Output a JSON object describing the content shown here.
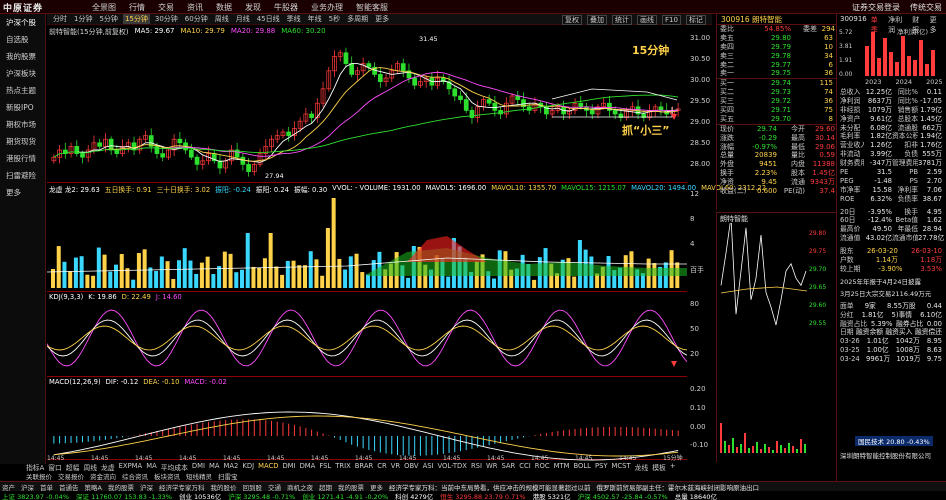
{
  "logo": "中原证券",
  "topmenu": [
    "全景图",
    "行情",
    "交易",
    "资讯",
    "数据",
    "发现",
    "牛股器",
    "业务办理",
    "智能客服"
  ],
  "topright": [
    "证券交易登录",
    "传统交易"
  ],
  "sidebar": [
    "沪深个股",
    "自选股",
    "我的股票",
    "沪深板块",
    "热点主题",
    "新股IPO",
    "期权市场",
    "期货现货",
    "港股行情",
    "扫雷避险",
    "更多"
  ],
  "toolbar": {
    "periods": [
      "分时",
      "1分钟",
      "5分钟",
      "15分钟",
      "30分钟",
      "60分钟",
      "周线",
      "月线",
      "45日线",
      "季线",
      "年线",
      "5秒",
      "多周期",
      "更多"
    ],
    "selected": "15分钟",
    "right": [
      "复权",
      "叠加",
      "统计",
      "画线",
      "F10",
      "标记"
    ]
  },
  "chart": {
    "title": "前特智能(15分钟,前复权)",
    "ma": [
      {
        "label": "MA5: 29.67",
        "color": "#ffffff"
      },
      {
        "label": "MA10: 29.79",
        "color": "#ffd24a"
      },
      {
        "label": "MA20: 29.88",
        "color": "#ff4dff"
      },
      {
        "label": "MA60: 30.20",
        "color": "#2ee02e"
      }
    ],
    "high_label": "31.45",
    "low_label": "27.94",
    "annot_period": "15分钟",
    "annot_pattern": "抓“小三”",
    "axis": [
      "31.00",
      "30.50",
      "30.00",
      "29.50",
      "29.00",
      "28.50",
      "28.00"
    ]
  },
  "vol": {
    "labels": [
      {
        "t": "龙虚 龙2: 29.63",
        "c": "#ffffff"
      },
      {
        "t": "五日换手: 0.91",
        "c": "#ffd24a"
      },
      {
        "t": "三十日换手: 3.02",
        "c": "#ffd24a"
      },
      {
        "t": "振阳: -0.24",
        "c": "#3ad8ff"
      },
      {
        "t": "振阳: 0.24",
        "c": "#ffffff"
      },
      {
        "t": "振幅: 0.30",
        "c": "#ffffff"
      },
      {
        "t": "VVOL: - VOLUME: 1931.00",
        "c": "#ffffff"
      },
      {
        "t": "MAVOL5: 1696.00",
        "c": "#ffffff"
      },
      {
        "t": "MAVOL10: 1355.70",
        "c": "#ffd24a"
      },
      {
        "t": "MAVOL15: 1215.07",
        "c": "#2ee02e"
      },
      {
        "t": "MAVOL20: 1494.00",
        "c": "#3ad8ff"
      },
      {
        "t": "MAVOL60: 2312.22",
        "c": "#ffd24a"
      }
    ],
    "axis": [
      "12",
      "8",
      "4",
      "百手"
    ]
  },
  "kdj": {
    "labels": [
      {
        "t": "KDJ(9,3,3)",
        "c": "#ffffff"
      },
      {
        "t": "K: 19.86",
        "c": "#ffffff"
      },
      {
        "t": "D: 22.49",
        "c": "#ffd24a"
      },
      {
        "t": "J: 14.60",
        "c": "#ff4dff"
      }
    ],
    "axis": [
      "80",
      "50",
      "20"
    ]
  },
  "macd": {
    "labels": [
      {
        "t": "MACD(12,26,9)",
        "c": "#ffffff"
      },
      {
        "t": "DIF: -0.12",
        "c": "#ffffff"
      },
      {
        "t": "DEA: -0.10",
        "c": "#ffd24a"
      },
      {
        "t": "MACD: -0.02",
        "c": "#ff4dff"
      }
    ],
    "axis": [
      "0.20",
      "0.10",
      "0.00",
      "-0.10"
    ],
    "time": [
      "14:45",
      "14:45",
      "14:45",
      "14:45",
      "14:45",
      "14:45",
      "14:45",
      "14:45",
      "14:45",
      "14:45",
      "14:45",
      "14:45",
      "14:45",
      "14:45",
      "15分钟"
    ]
  },
  "tabs": [
    "指标A",
    "窗口",
    "超幅",
    "周线",
    "龙虚",
    "EXPMA",
    "MA",
    "平均成本",
    "DMI",
    "MA",
    "MA2",
    "KDJ",
    "MACD",
    "DMI",
    "DMA",
    "FSL",
    "TRIX",
    "BRAR",
    "CR",
    "VR",
    "OBV",
    "ASI",
    "VOL-TDX",
    "RSI",
    "WR",
    "SAR",
    "CCI",
    "ROC",
    "MTM",
    "BOLL",
    "PSY",
    "MCST",
    "龙线",
    "模板",
    "+"
  ],
  "tabs_selected": "MACD",
  "tabs2": [
    "关联报价",
    "交易报价",
    "资金流向",
    "综合资讯",
    "板块资讯",
    "短线精灵",
    "扫雷宝"
  ],
  "quote": {
    "header": "300916 朗特智能",
    "wei": {
      "l": "委比",
      "v": "54.85%",
      "l2": "委差",
      "v2": "294"
    },
    "sell": [
      {
        "l": "卖五",
        "p": "29.80",
        "q": "63"
      },
      {
        "l": "卖四",
        "p": "29.79",
        "q": "10"
      },
      {
        "l": "卖三",
        "p": "29.78",
        "q": "34"
      },
      {
        "l": "卖二",
        "p": "29.77",
        "q": "6"
      },
      {
        "l": "卖一",
        "p": "29.75",
        "q": "36"
      }
    ],
    "buy": [
      {
        "l": "买一",
        "p": "29.74",
        "q": "115"
      },
      {
        "l": "买二",
        "p": "29.73",
        "q": "74"
      },
      {
        "l": "买三",
        "p": "29.72",
        "q": "36"
      },
      {
        "l": "买四",
        "p": "29.71",
        "q": "75"
      },
      {
        "l": "买五",
        "p": "29.70",
        "q": "8"
      }
    ],
    "stats": [
      [
        "现价",
        "29.74",
        "今开",
        "29.60"
      ],
      [
        "涨跌",
        "-0.29",
        "最高",
        "30.14"
      ],
      [
        "涨幅",
        "-0.97%",
        "最低",
        "29.06"
      ],
      [
        "总量",
        "20839",
        "量比",
        "0.59"
      ],
      [
        "外盘",
        "9451",
        "内盘",
        "11388"
      ],
      [
        "换手",
        "2.23%",
        "股本",
        "1.45亿"
      ],
      [
        "净资",
        "9.45",
        "流通",
        "9343万"
      ],
      [
        "收益(二)",
        "0.600",
        "PE(动)",
        "37.4"
      ]
    ]
  },
  "mini": {
    "title": "朗特智能",
    "axis": [
      "29.80",
      "29.75",
      "29.70",
      "29.65",
      "29.60",
      "29.55"
    ],
    "time": [
      "09:30",
      "10:30",
      "11:30/13:00",
      "14:00",
      "15:00"
    ]
  },
  "right": {
    "code": "300916",
    "tabs": [
      "单季",
      "净利润",
      "财报",
      "更多"
    ],
    "bars_label": "净利润(亿)",
    "bar_axis": [
      "5.72",
      "3.81",
      "1.91",
      "0.00"
    ],
    "years": [
      "2023",
      "2024",
      "2025"
    ],
    "rows": [
      [
        "总收入",
        "12.25亿",
        "同比%",
        "0.11"
      ],
      [
        "净利润",
        "8637万",
        "同比%",
        "-17.05"
      ],
      [
        "非经损",
        "1079万",
        "销售额",
        "1.79亿"
      ],
      [
        "净资产",
        "9.61亿",
        "总股本",
        "1.45亿"
      ],
      [
        "未分配",
        "6.08亿",
        "流通股",
        "662万"
      ],
      [
        "毛利率",
        "1.82亿",
        "资本公积",
        "1.94亿"
      ],
      [
        "营业收入",
        "1.26亿",
        "扣非",
        "1.76亿"
      ],
      [
        "非流动",
        "3.99亿",
        "负债",
        "555万"
      ],
      [
        "财务费用",
        "-347万",
        "管理费用",
        "3781万"
      ],
      [
        "PE",
        "31.5",
        "PB",
        "2.59"
      ],
      [
        "PEG",
        "-1.48",
        "PS",
        "2.70"
      ],
      [
        "市净率",
        "15.58",
        "净利率",
        "7.06"
      ],
      [
        "ROE",
        "6.32%",
        "负债率",
        "38.67"
      ]
    ],
    "chg": [
      [
        "20日",
        "-3.95%",
        "换手",
        "4.95"
      ],
      [
        "60日",
        "-12.4%",
        "Beta值",
        "1.62"
      ],
      [
        "最高价",
        "49.50",
        "年最低",
        "28.94"
      ],
      [
        "流通值",
        "43.02亿",
        "流通市值",
        "27.78亿"
      ]
    ],
    "dates": [
      [
        "股东",
        "26-03-20",
        "26-03-10"
      ],
      [
        "户数",
        "1.14万",
        "1.18万"
      ],
      [
        "较上期",
        "-3.90%",
        "3.53%"
      ]
    ],
    "notice": "2025年年报于4月24日披露",
    "notice2": "3月25日大宗交易2116.49万元",
    "extra": [
      [
        "面单",
        "9家",
        "8.55万股",
        "0.44"
      ],
      [
        "分红",
        "1.81亿",
        "5)事情",
        "6.10亿"
      ],
      [
        "融资占比",
        "5.39%",
        "融券占比",
        "0.00"
      ],
      [
        "日期",
        "融资余额",
        "融资买入",
        "融资偿还"
      ],
      [
        "03-26",
        "1.01亿",
        "1042万",
        "8.95"
      ],
      [
        "03-25",
        "1.00亿",
        "1008万",
        "8.63"
      ],
      [
        "03-24",
        "9961万",
        "1019万",
        "9.75"
      ]
    ],
    "bottom": "国民技术 20.80 -0.43%",
    "company": "深圳朗特智能控制股份有限公司"
  },
  "bottom": [
    "资产",
    "沪深",
    "首单",
    "首通告",
    "策略A",
    "我的股票",
    "沪深",
    "经济学专家万科",
    "我的股价",
    "回到股",
    "交通",
    "商机之夜",
    "超期",
    "我的股票",
    "更多"
  ],
  "status": [
    {
      "t": "上证 3823.97 -0.04%",
      "c": "#2ee02e"
    },
    {
      "t": "深证 11760.07 153.83 -1.33%",
      "c": "#2ee02e"
    },
    {
      "t": "创业 10536亿",
      "c": "#ffffff"
    },
    {
      "t": "沪深 3295.48 -0.71%",
      "c": "#2ee02e"
    },
    {
      "t": "创业 1271.41 -4.91 -0.20%",
      "c": "#2ee02e"
    },
    {
      "t": "科创 4279亿",
      "c": "#ffffff"
    },
    {
      "t": "恒生 3295.88 23.79 0.71%",
      "c": "#ff3b3b"
    },
    {
      "t": "港股 5321亿",
      "c": "#ffffff"
    },
    {
      "t": "沪深 4502.57 -25.84 -0.57%",
      "c": "#2ee02e"
    },
    {
      "t": "总量 18640亿",
      "c": "#ffffff"
    }
  ],
  "ticker": "经济学专家万科：当前中东局势看，供应冲击的规模可能显著超过以前",
  "ticker2": "俄罗斯前贸易部副主任：霍尔木兹海峡封闭影响原油出口",
  "colors": {
    "up": "#ff3b3b",
    "down": "#2ee02e",
    "ma5": "#ffffff",
    "ma10": "#ffd24a",
    "ma20": "#ff4dff",
    "ma60": "#2ee02e"
  }
}
